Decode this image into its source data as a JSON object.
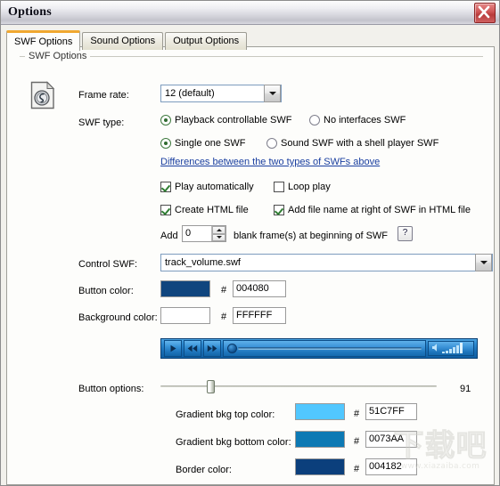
{
  "window": {
    "title": "Options",
    "close_label": "×"
  },
  "tabs": [
    {
      "label": "SWF Options",
      "active": true
    },
    {
      "label": "Sound Options",
      "active": false
    },
    {
      "label": "Output Options",
      "active": false
    }
  ],
  "group": {
    "label": "SWF Options"
  },
  "frame_rate": {
    "label": "Frame rate:",
    "value": "12 (default)",
    "icon": "flash-file-icon"
  },
  "swf_type": {
    "label": "SWF type:",
    "options": [
      {
        "label": "Playback controllable SWF",
        "selected": true
      },
      {
        "label": "No interfaces SWF",
        "selected": false
      },
      {
        "label": "Single one SWF",
        "selected": true
      },
      {
        "label": "Sound SWF with a shell player SWF",
        "selected": false
      }
    ],
    "link": "Differences between the two types of SWFs above"
  },
  "checkboxes": [
    {
      "label": "Play automatically",
      "checked": true
    },
    {
      "label": "Loop play",
      "checked": false
    },
    {
      "label": "Create HTML file",
      "checked": true
    },
    {
      "label": "Add file name at right of SWF in HTML file",
      "checked": true
    }
  ],
  "blank_frames": {
    "prefix": "Add",
    "value": "0",
    "suffix": "blank frame(s) at beginning of SWF",
    "help": "?"
  },
  "control_swf": {
    "label": "Control SWF:",
    "value": "track_volume.swf"
  },
  "colors": [
    {
      "label": "Button color:",
      "hash": "#",
      "value": "004080",
      "swatch": "#10457e"
    },
    {
      "label": "Background color:",
      "hash": "#",
      "value": "FFFFFF",
      "swatch": "#ffffff"
    }
  ],
  "player_preview": {
    "play": "play-icon",
    "rewind": "rewind-icon",
    "forward": "fast-forward-icon",
    "volume": "volume-icon"
  },
  "button_options": {
    "label": "Button options:",
    "value": "91"
  },
  "gradient_colors": [
    {
      "label": "Gradient bkg top color:",
      "hash": "#",
      "value": "51C7FF",
      "swatch": "#51c7ff"
    },
    {
      "label": "Gradient bkg bottom color:",
      "hash": "#",
      "value": "0073AA",
      "swatch": "#0c79b4"
    },
    {
      "label": "Border color:",
      "hash": "#",
      "value": "004182",
      "swatch": "#0b3f7c"
    }
  ],
  "watermark": {
    "text": "下载吧",
    "url": "www.xiazaiba.com"
  }
}
